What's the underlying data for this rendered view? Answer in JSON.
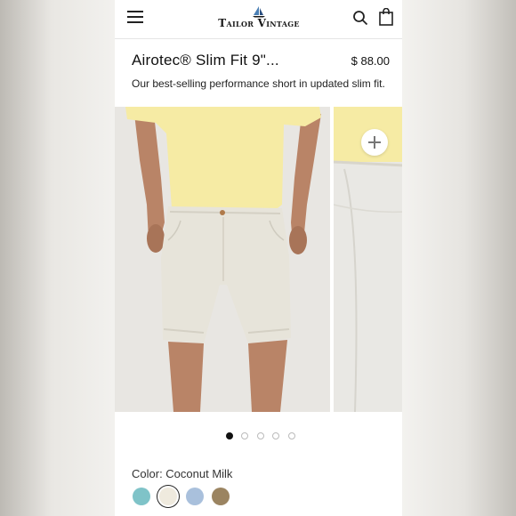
{
  "header": {
    "brand": "Tailor Vintage",
    "menu_icon": "hamburger-menu-icon",
    "search_icon": "search-icon",
    "cart_icon": "shopping-bag-icon"
  },
  "product": {
    "title": "Airotec® Slim Fit 9\"...",
    "price": "$ 88.00",
    "subtitle": "Our best-selling performance short in updated slim fit."
  },
  "gallery": {
    "zoom_icon": "plus-icon",
    "slide_count": 5,
    "active_slide": 1
  },
  "color": {
    "label": "Color: Coconut Milk",
    "swatches": [
      {
        "name": "teal",
        "hex": "#7fc3c8"
      },
      {
        "name": "Coconut Milk",
        "hex": "#efeade",
        "selected": true
      },
      {
        "name": "light blue",
        "hex": "#a9c0dc"
      },
      {
        "name": "khaki",
        "hex": "#9b8461"
      }
    ]
  },
  "colors": {
    "shirt": "#f6eba4",
    "shorts": "#e6e3d9",
    "skin": "#b98467",
    "background": "#e7e5e1"
  }
}
